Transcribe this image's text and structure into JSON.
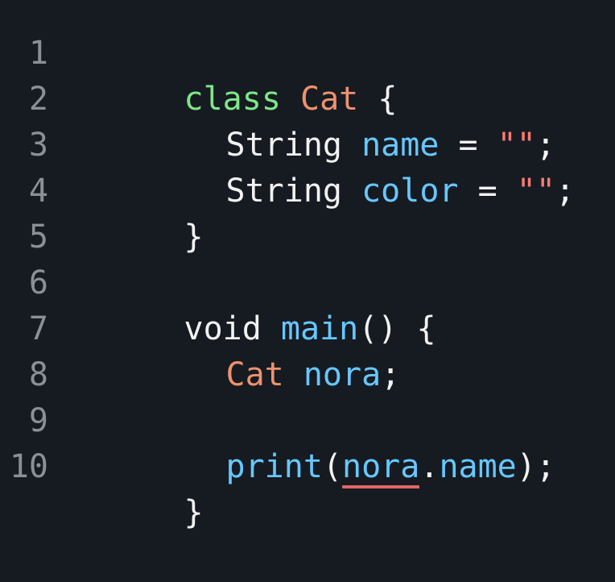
{
  "lines": [
    {
      "number": "1",
      "tokens": [
        {
          "text": "class",
          "kind": "kw"
        },
        {
          "text": " ",
          "kind": "plain"
        },
        {
          "text": "Cat",
          "kind": "type"
        },
        {
          "text": " {",
          "kind": "punc"
        }
      ]
    },
    {
      "number": "2",
      "tokens": [
        {
          "text": "String",
          "kind": "plain"
        },
        {
          "text": " ",
          "kind": "plain"
        },
        {
          "text": "name",
          "kind": "ident"
        },
        {
          "text": " = ",
          "kind": "plain"
        },
        {
          "text": "\"\"",
          "kind": "str"
        },
        {
          "text": ";",
          "kind": "punc"
        }
      ]
    },
    {
      "number": "3",
      "tokens": [
        {
          "text": "String",
          "kind": "plain"
        },
        {
          "text": " ",
          "kind": "plain"
        },
        {
          "text": "color",
          "kind": "ident"
        },
        {
          "text": " = ",
          "kind": "plain"
        },
        {
          "text": "\"\"",
          "kind": "str"
        },
        {
          "text": ";",
          "kind": "punc"
        }
      ]
    },
    {
      "number": "4",
      "tokens": [
        {
          "text": "}",
          "kind": "punc"
        }
      ]
    },
    {
      "number": "5",
      "tokens": []
    },
    {
      "number": "6",
      "tokens": [
        {
          "text": "void",
          "kind": "plain"
        },
        {
          "text": " ",
          "kind": "plain"
        },
        {
          "text": "main",
          "kind": "ident"
        },
        {
          "text": "() {",
          "kind": "punc"
        }
      ]
    },
    {
      "number": "7",
      "tokens": [
        {
          "text": "Cat",
          "kind": "type"
        },
        {
          "text": " ",
          "kind": "plain"
        },
        {
          "text": "nora",
          "kind": "ident"
        },
        {
          "text": ";",
          "kind": "punc"
        }
      ]
    },
    {
      "number": "8",
      "tokens": []
    },
    {
      "number": "9",
      "tokens": [
        {
          "text": "print",
          "kind": "ident"
        },
        {
          "text": "(",
          "kind": "punc"
        },
        {
          "text": "nora",
          "kind": "ident",
          "error": true
        },
        {
          "text": ".",
          "kind": "plain"
        },
        {
          "text": "name",
          "kind": "ident"
        },
        {
          "text": ");",
          "kind": "punc"
        }
      ]
    },
    {
      "number": "10",
      "tokens": [
        {
          "text": "}",
          "kind": "punc"
        }
      ]
    }
  ],
  "colors": {
    "background": "#161b22",
    "keyword": "#7ee787",
    "type": "#f0916d",
    "identifier": "#67c7ff",
    "string": "#ff7b72",
    "error_underline": "#e06666"
  }
}
